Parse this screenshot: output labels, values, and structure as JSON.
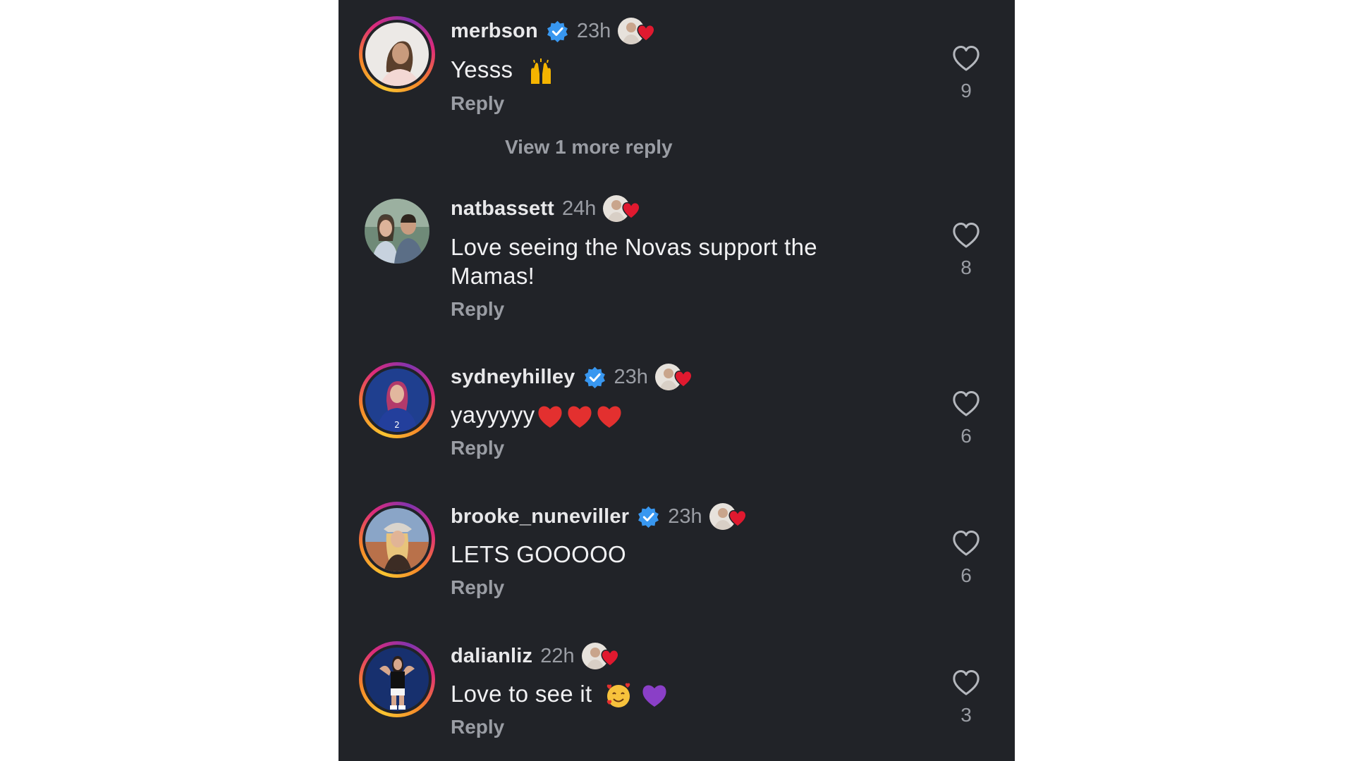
{
  "colors": {
    "panel_bg": "#212328",
    "text_primary": "#f1f1f3",
    "text_secondary": "#9a9da4",
    "verified_blue": "#3897f0",
    "heart_red": "#e0192f"
  },
  "view_more_replies": "View 1 more reply",
  "comments": [
    {
      "username": "merbson",
      "verified": true,
      "time": "23h",
      "text": "Yesss",
      "emojis": [
        "raising-hands"
      ],
      "reply_label": "Reply",
      "likes": "9",
      "story_ring": true,
      "liked_by_creator": true
    },
    {
      "username": "natbassett",
      "verified": false,
      "time": "24h",
      "text": "Love seeing the Novas support the Mamas!",
      "emojis": [],
      "reply_label": "Reply",
      "likes": "8",
      "story_ring": false,
      "liked_by_creator": true
    },
    {
      "username": "sydneyhilley",
      "verified": true,
      "time": "23h",
      "text": "yayyyyy",
      "emojis": [
        "red-heart",
        "red-heart",
        "red-heart"
      ],
      "reply_label": "Reply",
      "likes": "6",
      "story_ring": true,
      "liked_by_creator": true
    },
    {
      "username": "brooke_nuneviller",
      "verified": true,
      "time": "23h",
      "text": "LETS GOOOOO",
      "emojis": [],
      "reply_label": "Reply",
      "likes": "6",
      "story_ring": true,
      "liked_by_creator": true
    },
    {
      "username": "dalianliz",
      "verified": false,
      "time": "22h",
      "text": "Love to see it",
      "emojis": [
        "smiling-face-with-hearts",
        "purple-heart"
      ],
      "reply_label": "Reply",
      "likes": "3",
      "story_ring": true,
      "liked_by_creator": true
    }
  ]
}
